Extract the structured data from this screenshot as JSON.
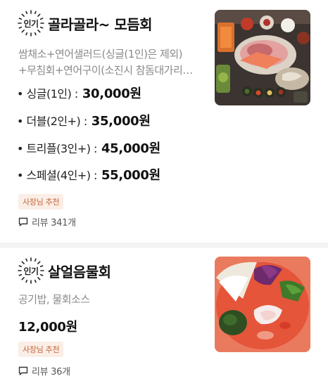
{
  "items": [
    {
      "badge": "인기",
      "name": "골라골라~ 모듬회",
      "description_lines": [
        "쌈채소+연어샐러드(싱글(1인)은 제외)",
        "+무침회+연어구이(소진시 참돔대가리…"
      ],
      "prices": [
        {
          "label": "• 싱글(1인) :",
          "value": "30,000원"
        },
        {
          "label": "• 더블(2인+) :",
          "value": "35,000원"
        },
        {
          "label": "• 트리플(3인+) :",
          "value": "45,000원"
        },
        {
          "label": "• 스페셜(4인+) :",
          "value": "55,000원"
        }
      ],
      "owner_badge": "사장님 추천",
      "reviews": "리뷰 341개",
      "icon": "speech-bubble-icon"
    },
    {
      "badge": "인기",
      "name": "살얼음물회",
      "description": "공기밥, 물회소스",
      "price": "12,000원",
      "owner_badge": "사장님 추천",
      "reviews": "리뷰 36개",
      "icon": "speech-bubble-icon"
    }
  ],
  "colors": {
    "owner_badge_bg": "#fbeee6",
    "owner_badge_text": "#c2643a",
    "description": "#8a8a8a",
    "divider": "#f4f4f4"
  }
}
